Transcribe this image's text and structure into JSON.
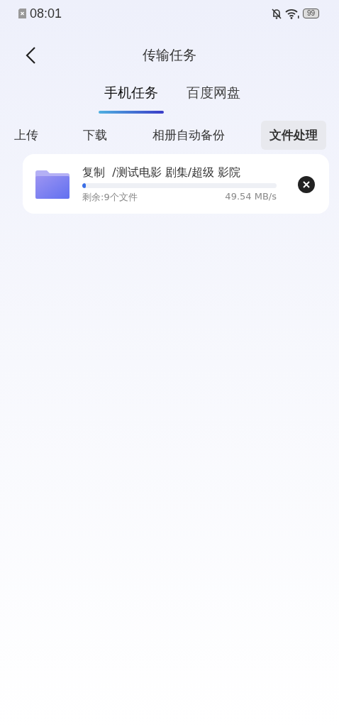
{
  "status_bar": {
    "time": "08:01",
    "battery": "99"
  },
  "header": {
    "title": "传输任务"
  },
  "top_tabs": [
    {
      "label": "手机任务",
      "selected": true
    },
    {
      "label": "百度网盘",
      "selected": false
    }
  ],
  "sub_tabs": [
    {
      "label": "上传",
      "selected": false
    },
    {
      "label": "下载",
      "selected": false
    },
    {
      "label": "相册自动备份",
      "selected": false
    },
    {
      "label": "文件处理",
      "selected": true
    }
  ],
  "tasks": [
    {
      "title": "复制  /测试电影 剧集/超级 影院",
      "level": 0.02,
      "remaining": "剩余:9个文件",
      "speed": "49.54 MB/s"
    }
  ]
}
